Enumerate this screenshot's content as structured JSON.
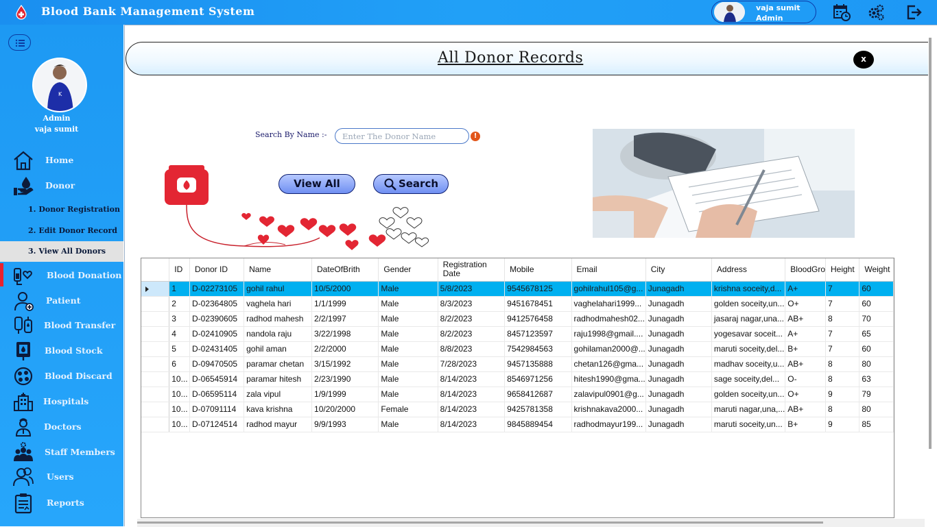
{
  "app": {
    "title": "Blood Bank Management System",
    "user_name": "vaja sumit",
    "user_role": "Admin"
  },
  "topbar": {
    "icons": [
      "calendar-clock-icon",
      "settings-gears-icon",
      "logout-icon"
    ]
  },
  "sidebar": {
    "role": "Admin",
    "name": "vaja sumit",
    "items": [
      {
        "label": "Home",
        "icon": "home-icon"
      },
      {
        "label": "Donor",
        "icon": "donor-drop-hand-icon"
      },
      {
        "label": "Blood Donation",
        "icon": "blood-donation-icon"
      },
      {
        "label": "Patient",
        "icon": "patient-icon"
      },
      {
        "label": "Blood Transfer",
        "icon": "blood-transfer-icon"
      },
      {
        "label": "Blood Stock",
        "icon": "blood-stock-icon"
      },
      {
        "label": "Blood Discard",
        "icon": "blood-discard-icon"
      },
      {
        "label": "Hospitals",
        "icon": "hospital-icon"
      },
      {
        "label": "Doctors",
        "icon": "doctor-icon"
      },
      {
        "label": "Staff Members",
        "icon": "staff-icon"
      },
      {
        "label": "Users",
        "icon": "users-icon"
      },
      {
        "label": "Reports",
        "icon": "reports-icon"
      }
    ],
    "donor_sub": [
      {
        "label": "1.  Donor Registration"
      },
      {
        "label": "2.  Edit Donor Record"
      },
      {
        "label": "3.  View All Donors"
      }
    ]
  },
  "page": {
    "title": "All Donor Records",
    "close_label": "x",
    "search_label": "Search By Name  :-",
    "search_placeholder": "Enter The Donor Name",
    "search_value": "",
    "warn_label": "!",
    "view_all_label": "View All",
    "search_button_label": "Search"
  },
  "table": {
    "columns": [
      "ID",
      "Donor ID",
      "Name",
      "DateOfBrith",
      "Gender",
      "Registration Date",
      "Mobile",
      "Email",
      "City",
      "Address",
      "BloodGro",
      "Height",
      "Weight"
    ],
    "rows": [
      [
        "1",
        "D-02273105",
        "gohil rahul",
        "10/5/2000",
        "Male",
        "5/8/2023",
        "9545678125",
        "gohilrahul105@g...",
        "Junagadh",
        "krishna soceity,d...",
        "A+",
        "7",
        "60"
      ],
      [
        "2",
        "D-02364805",
        "vaghela hari",
        "1/1/1999",
        "Male",
        "8/3/2023",
        "9451678451",
        "vaghelahari1999...",
        "Junagadh",
        "golden soceity,un...",
        "O+",
        "7",
        "60"
      ],
      [
        "3",
        "D-02390605",
        "radhod mahesh",
        "2/2/1997",
        "Male",
        "8/2/2023",
        "9412576458",
        "radhodmahesh02...",
        "Junagadh",
        "jasaraj nagar,una...",
        "AB+",
        "8",
        "70"
      ],
      [
        "4",
        "D-02410905",
        "nandola raju",
        "3/22/1998",
        "Male",
        "8/2/2023",
        "8457123597",
        "raju1998@gmail....",
        "Junagadh",
        "yogesavar soceit...",
        "A+",
        "7",
        "65"
      ],
      [
        "5",
        "D-02431405",
        "gohil aman",
        "2/2/2000",
        "Male",
        "8/8/2023",
        "7542984563",
        "gohilaman2000@...",
        "Junagadh",
        "maruti soceity,del...",
        "B+",
        "7",
        "60"
      ],
      [
        "6",
        "D-09470505",
        "paramar chetan",
        "3/15/1992",
        "Male",
        "7/28/2023",
        "9457135888",
        "chetan126@gma...",
        "Junagadh",
        "madhav soceity,u...",
        "AB+",
        "8",
        "80"
      ],
      [
        "10...",
        "D-06545914",
        "paramar hitesh",
        "2/23/1990",
        "Male",
        "8/14/2023",
        "8546971256",
        "hitesh1990@gma...",
        "Junagadh",
        "sage soceity,del...",
        "O-",
        "8",
        "63"
      ],
      [
        "10...",
        "D-06595114",
        "zala vipul",
        "1/9/1999",
        "Male",
        "8/14/2023",
        "9658412687",
        "zalavipul0901@g...",
        "Junagadh",
        "golden soceity,un...",
        "O+",
        "9",
        "79"
      ],
      [
        "10...",
        "D-07091114",
        "kava krishna",
        "10/20/2000",
        "Female",
        "8/14/2023",
        "9425781358",
        "krishnakava2000...",
        "Junagadh",
        "maruti nagar,una,...",
        "AB+",
        "8",
        "80"
      ],
      [
        "10...",
        "D-07124514",
        "radhod mayur",
        "9/9/1993",
        "Male",
        "8/14/2023",
        "9845889454",
        "radhodmayur199...",
        "Junagadh",
        "maruti soceity,un...",
        "B+",
        "9",
        "85"
      ]
    ],
    "selected_row": 0
  },
  "colors": {
    "accent": "#1d99f3",
    "selected_row": "#00b0f0",
    "active_marker": "#e8222f",
    "button": "#6f8ff2"
  }
}
